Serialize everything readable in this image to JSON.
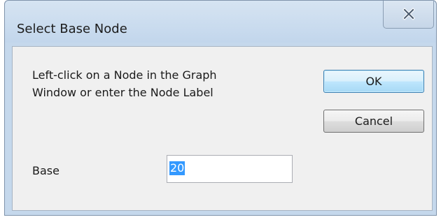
{
  "dialog": {
    "title": "Select Base Node",
    "message_line1": "Left-click on a Node in the Graph",
    "message_line2": "Window or enter the Node Label",
    "ok_label": "OK",
    "cancel_label": "Cancel",
    "base_label": "Base",
    "base_value": "20",
    "close_icon": "close-icon"
  },
  "colors": {
    "titlebar": "#c5d8ec",
    "client": "#f0f0f0",
    "selection": "#3399ff",
    "ok_border": "#3c7fb1"
  }
}
